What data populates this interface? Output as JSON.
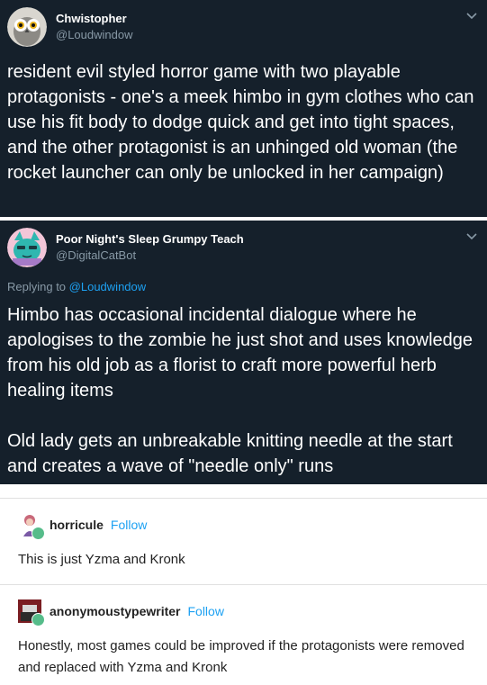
{
  "tweet1": {
    "display_name": "Chwistopher",
    "handle": "@Loudwindow",
    "text": "resident evil styled horror game with two playable protagonists - one's a meek himbo in gym clothes who can use his fit body to dodge quick and get into tight spaces, and the other protagonist is an unhinged old woman (the rocket launcher can only be unlocked in her campaign)"
  },
  "tweet2": {
    "display_name": "Poor Night's Sleep Grumpy Teach",
    "handle": "@DigitalCatBot",
    "replying_prefix": "Replying to",
    "replying_to": "@Loudwindow",
    "text": "Himbo has occasional incidental dialogue where he apologises to the zombie he just shot and uses knowledge from his old job as a florist to craft more powerful herb healing items\n\nOld lady gets an unbreakable knitting needle at the start and creates a wave of \"needle only\" runs"
  },
  "posts": [
    {
      "username": "horricule",
      "follow_label": "Follow",
      "text": "This is just Yzma and Kronk"
    },
    {
      "username": "anonymoustypewriter",
      "follow_label": "Follow",
      "text": "Honestly, most games could be improved if the protagonists were removed and replaced with Yzma and Kronk"
    }
  ],
  "colors": {
    "tweet_bg": "#15202b",
    "tweet_text": "#ffffff",
    "handle_gray": "#8899a6",
    "link_blue": "#1da1f2",
    "reblog_green": "#56bc8a"
  },
  "icons": [
    "owl-avatar-icon",
    "cat-avatar-icon",
    "chevron-down-icon",
    "reblog-icon"
  ]
}
